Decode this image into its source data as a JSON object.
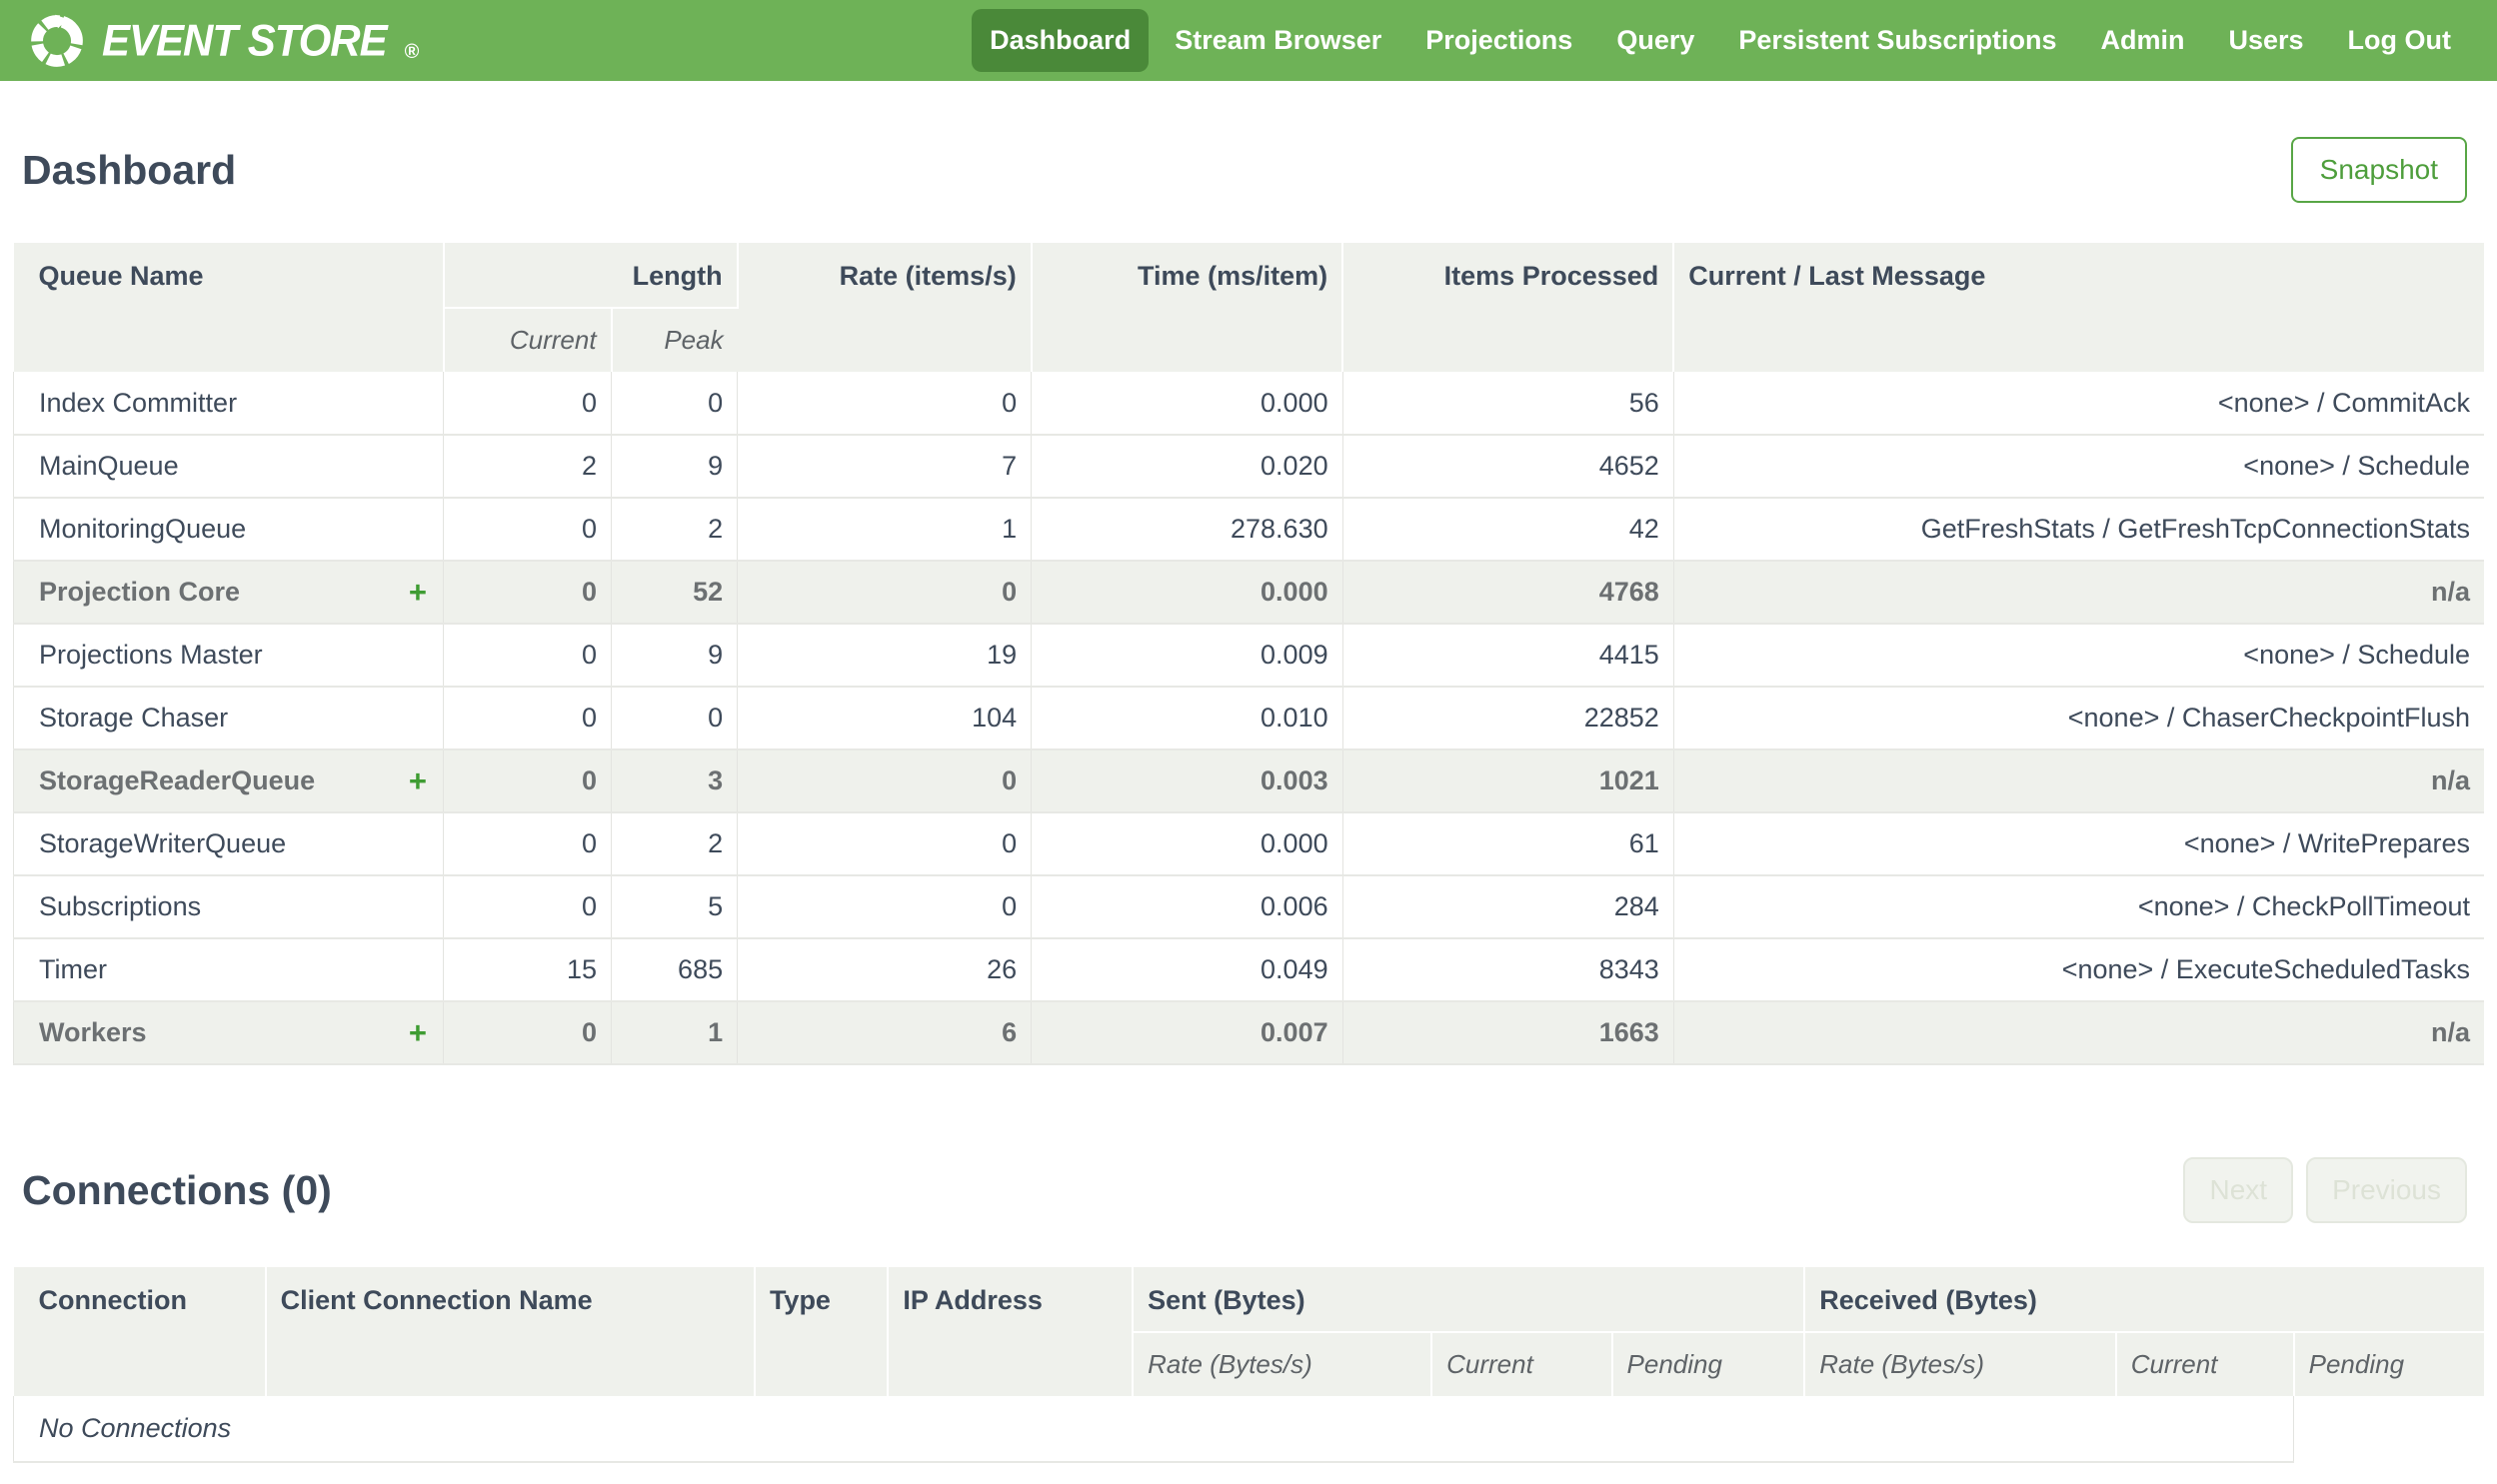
{
  "navbar": {
    "brand": "EVENT STORE",
    "brand_mark": "®",
    "items": [
      {
        "label": "Dashboard",
        "active": true
      },
      {
        "label": "Stream Browser",
        "active": false
      },
      {
        "label": "Projections",
        "active": false
      },
      {
        "label": "Query",
        "active": false
      },
      {
        "label": "Persistent Subscriptions",
        "active": false
      },
      {
        "label": "Admin",
        "active": false
      },
      {
        "label": "Users",
        "active": false
      },
      {
        "label": "Log Out",
        "active": false
      }
    ]
  },
  "page": {
    "title": "Dashboard",
    "snapshot_button": "Snapshot"
  },
  "queues_table": {
    "expand_symbol": "+",
    "headers": {
      "queue_name": "Queue Name",
      "length": "Length",
      "current": "Current",
      "peak": "Peak",
      "rate": "Rate (items/s)",
      "time": "Time (ms/item)",
      "items_processed": "Items Processed",
      "message": "Current / Last Message"
    },
    "rows": [
      {
        "name": "Index Committer",
        "group": false,
        "current": "0",
        "peak": "0",
        "rate": "0",
        "time": "0.000",
        "items": "56",
        "message": "<none> / CommitAck"
      },
      {
        "name": "MainQueue",
        "group": false,
        "current": "2",
        "peak": "9",
        "rate": "7",
        "time": "0.020",
        "items": "4652",
        "message": "<none> / Schedule"
      },
      {
        "name": "MonitoringQueue",
        "group": false,
        "current": "0",
        "peak": "2",
        "rate": "1",
        "time": "278.630",
        "items": "42",
        "message": "GetFreshStats / GetFreshTcpConnectionStats"
      },
      {
        "name": "Projection Core",
        "group": true,
        "current": "0",
        "peak": "52",
        "rate": "0",
        "time": "0.000",
        "items": "4768",
        "message": "n/a"
      },
      {
        "name": "Projections Master",
        "group": false,
        "current": "0",
        "peak": "9",
        "rate": "19",
        "time": "0.009",
        "items": "4415",
        "message": "<none> / Schedule"
      },
      {
        "name": "Storage Chaser",
        "group": false,
        "current": "0",
        "peak": "0",
        "rate": "104",
        "time": "0.010",
        "items": "22852",
        "message": "<none> / ChaserCheckpointFlush"
      },
      {
        "name": "StorageReaderQueue",
        "group": true,
        "current": "0",
        "peak": "3",
        "rate": "0",
        "time": "0.003",
        "items": "1021",
        "message": "n/a"
      },
      {
        "name": "StorageWriterQueue",
        "group": false,
        "current": "0",
        "peak": "2",
        "rate": "0",
        "time": "0.000",
        "items": "61",
        "message": "<none> / WritePrepares"
      },
      {
        "name": "Subscriptions",
        "group": false,
        "current": "0",
        "peak": "5",
        "rate": "0",
        "time": "0.006",
        "items": "284",
        "message": "<none> / CheckPollTimeout"
      },
      {
        "name": "Timer",
        "group": false,
        "current": "15",
        "peak": "685",
        "rate": "26",
        "time": "0.049",
        "items": "8343",
        "message": "<none> / ExecuteScheduledTasks"
      },
      {
        "name": "Workers",
        "group": true,
        "current": "0",
        "peak": "1",
        "rate": "6",
        "time": "0.007",
        "items": "1663",
        "message": "n/a"
      }
    ]
  },
  "connections": {
    "title": "Connections (0)",
    "pager": {
      "next": "Next",
      "previous": "Previous"
    },
    "headers": {
      "connection": "Connection",
      "client_name": "Client Connection Name",
      "type": "Type",
      "ip": "IP Address",
      "sent": "Sent (Bytes)",
      "received": "Received (Bytes)",
      "rate": "Rate (Bytes/s)",
      "current": "Current",
      "pending": "Pending"
    },
    "empty": "No Connections"
  },
  "colors": {
    "navbar_green": "#6EB257",
    "active_item_green": "#4A8939",
    "accent_green": "#3E9C32",
    "snapshot_green": "#4E9E3C",
    "header_bg": "#EFF1EC",
    "text_dark": "#3E4A5A",
    "muted_gray": "#6C7072"
  }
}
